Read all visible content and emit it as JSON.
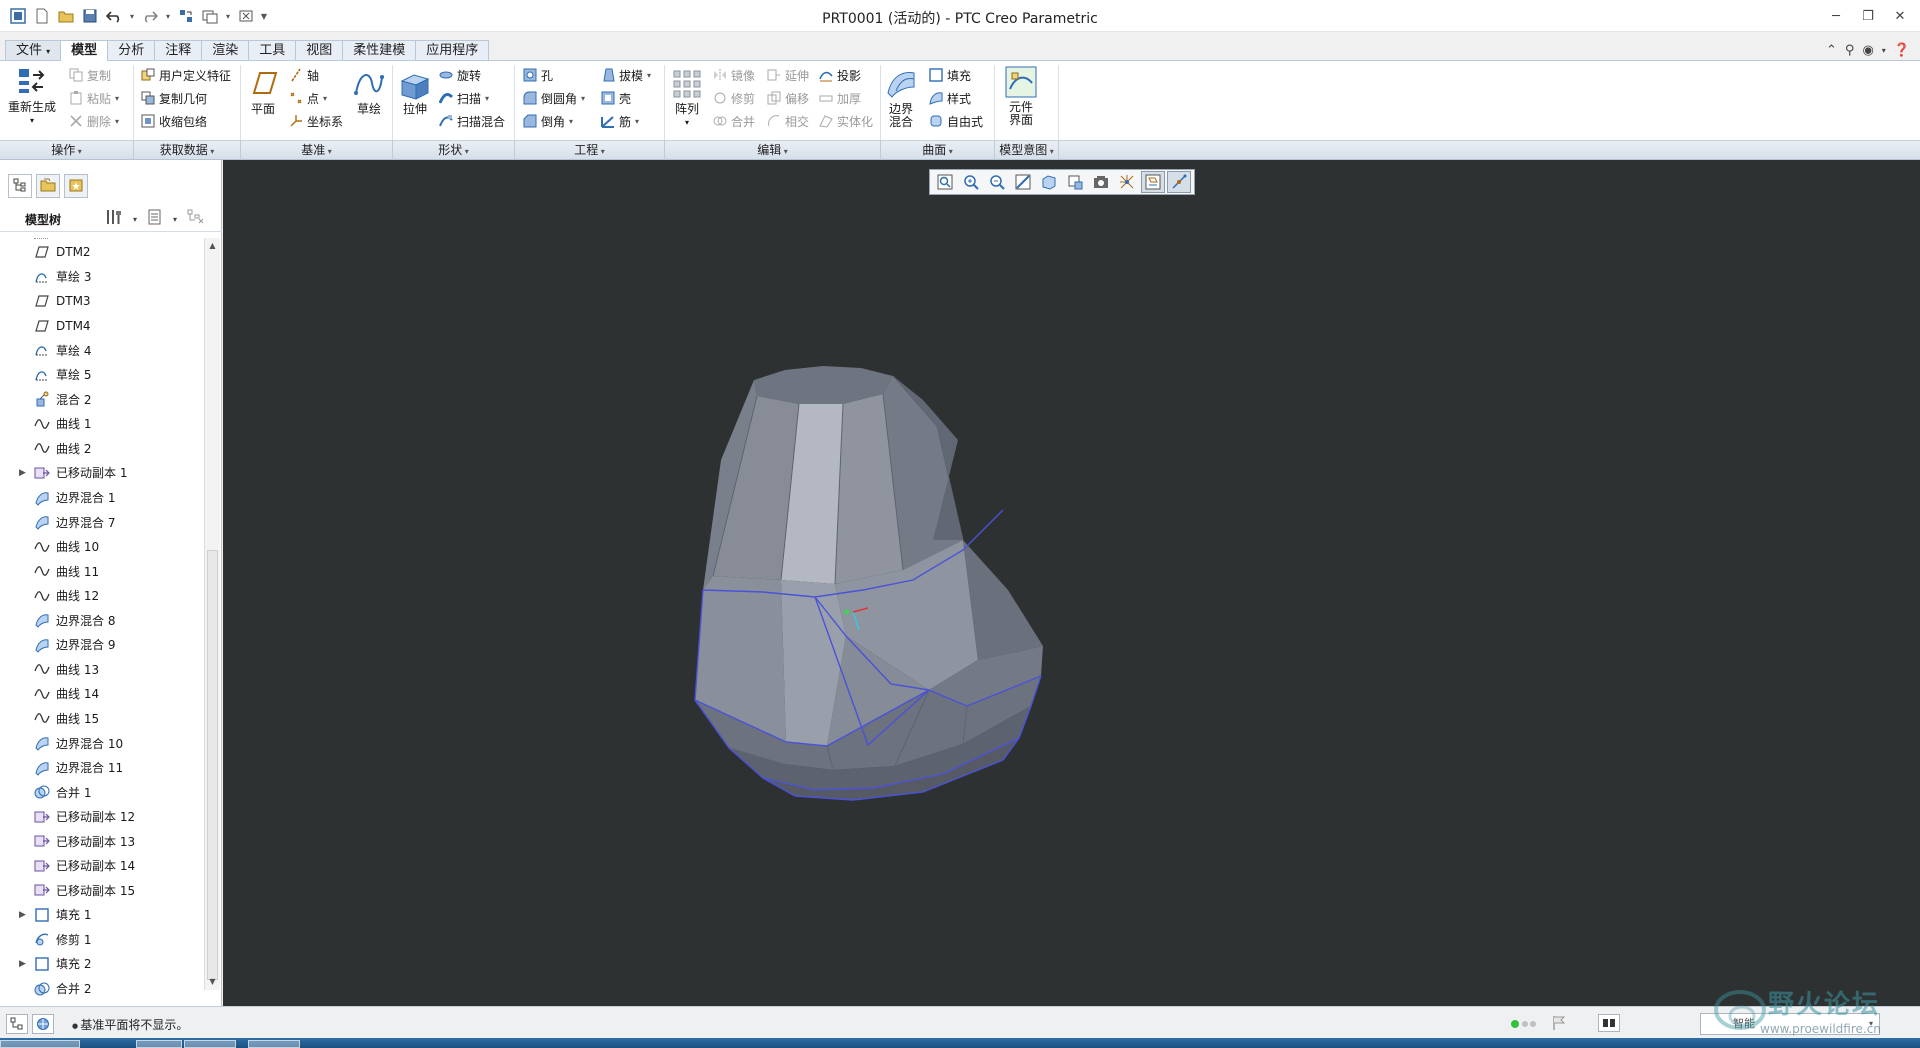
{
  "window": {
    "title": "PRT0001 (活动的) - PTC Creo Parametric"
  },
  "ribbon_tabs": [
    {
      "label": "文件"
    },
    {
      "label": "模型"
    },
    {
      "label": "分析"
    },
    {
      "label": "注释"
    },
    {
      "label": "渲染"
    },
    {
      "label": "工具"
    },
    {
      "label": "视图"
    },
    {
      "label": "柔性建模"
    },
    {
      "label": "应用程序"
    }
  ],
  "ribbon": {
    "operations": {
      "regenerate": "重新生成",
      "copy": "复制",
      "paste": "粘贴",
      "delete": "删除"
    },
    "get_data": {
      "udf": "用户定义特征",
      "copy_geom": "复制几何",
      "shrinkwrap": "收缩包络"
    },
    "datum": {
      "plane": "平面",
      "axis": "轴",
      "point": "点",
      "csys": "坐标系",
      "sketch": "草绘"
    },
    "shapes": {
      "extrude": "拉伸",
      "revolve": "旋转",
      "sweep": "扫描",
      "swept_blend": "扫描混合"
    },
    "engineering": {
      "hole": "孔",
      "round": "倒圆角",
      "chamfer": "倒角",
      "draft": "拔模",
      "shell": "壳",
      "rib": "筋"
    },
    "editing": {
      "pattern": "阵列",
      "mirror": "镜像",
      "trim": "修剪",
      "merge": "合并",
      "extend": "延伸",
      "offset": "偏移",
      "intersect": "相交",
      "project": "投影",
      "thicken": "加厚",
      "solidify": "实体化"
    },
    "surfaces": {
      "boundary_blend": "边界混合",
      "fill": "填充",
      "style": "样式",
      "freestyle": "自由式"
    },
    "model_intent": {
      "component_interface": "元件界面"
    },
    "groups": {
      "operations": "操作",
      "get_data": "获取数据",
      "datum": "基准",
      "shapes": "形状",
      "engineering": "工程",
      "editing": "编辑",
      "surfaces": "曲面",
      "model_intent": "模型意图"
    }
  },
  "model_tree": {
    "title": "模型树",
    "items": [
      {
        "label": "DTM2",
        "icon": "datum-plane-icon",
        "expandable": false
      },
      {
        "label": "草绘 3",
        "icon": "sketch-icon",
        "expandable": false
      },
      {
        "label": "DTM3",
        "icon": "datum-plane-icon",
        "expandable": false
      },
      {
        "label": "DTM4",
        "icon": "datum-plane-icon",
        "expandable": false
      },
      {
        "label": "草绘 4",
        "icon": "sketch-icon",
        "expandable": false
      },
      {
        "label": "草绘 5",
        "icon": "sketch-icon",
        "expandable": false
      },
      {
        "label": "混合 2",
        "icon": "blend-icon",
        "expandable": false
      },
      {
        "label": "曲线 1",
        "icon": "curve-icon",
        "expandable": false
      },
      {
        "label": "曲线 2",
        "icon": "curve-icon",
        "expandable": false
      },
      {
        "label": "已移动副本 1",
        "icon": "moved-copy-icon",
        "expandable": true
      },
      {
        "label": "边界混合 1",
        "icon": "boundary-blend-icon",
        "expandable": false
      },
      {
        "label": "边界混合 7",
        "icon": "boundary-blend-icon",
        "expandable": false
      },
      {
        "label": "曲线 10",
        "icon": "curve-icon",
        "expandable": false
      },
      {
        "label": "曲线 11",
        "icon": "curve-icon",
        "expandable": false
      },
      {
        "label": "曲线 12",
        "icon": "curve-icon",
        "expandable": false
      },
      {
        "label": "边界混合 8",
        "icon": "boundary-blend-icon",
        "expandable": false
      },
      {
        "label": "边界混合 9",
        "icon": "boundary-blend-icon",
        "expandable": false
      },
      {
        "label": "曲线 13",
        "icon": "curve-icon",
        "expandable": false
      },
      {
        "label": "曲线 14",
        "icon": "curve-icon",
        "expandable": false
      },
      {
        "label": "曲线 15",
        "icon": "curve-icon",
        "expandable": false
      },
      {
        "label": "边界混合 10",
        "icon": "boundary-blend-icon",
        "expandable": false
      },
      {
        "label": "边界混合 11",
        "icon": "boundary-blend-icon",
        "expandable": false
      },
      {
        "label": "合并 1",
        "icon": "merge-icon",
        "expandable": false
      },
      {
        "label": "已移动副本 12",
        "icon": "moved-copy-icon",
        "expandable": false
      },
      {
        "label": "已移动副本 13",
        "icon": "moved-copy-icon",
        "expandable": false
      },
      {
        "label": "已移动副本 14",
        "icon": "moved-copy-icon",
        "expandable": false
      },
      {
        "label": "已移动副本 15",
        "icon": "moved-copy-icon",
        "expandable": false
      },
      {
        "label": "填充 1",
        "icon": "fill-icon",
        "expandable": true
      },
      {
        "label": "修剪 1",
        "icon": "trim-icon",
        "expandable": false
      },
      {
        "label": "填充 2",
        "icon": "fill-icon",
        "expandable": true
      },
      {
        "label": "合并 2",
        "icon": "merge-icon",
        "expandable": false
      }
    ]
  },
  "status": {
    "message": "基准平面将不显示。",
    "filter": "智能"
  },
  "watermark": {
    "brand": "野火论坛",
    "url": "www.proewildfire.cn"
  },
  "colors": {
    "graphics_bg": "#2d3132",
    "model_fill": "#9aa0ad",
    "edge_highlight": "#4a52d6",
    "ribbon_accent": "#b9c7d6"
  }
}
